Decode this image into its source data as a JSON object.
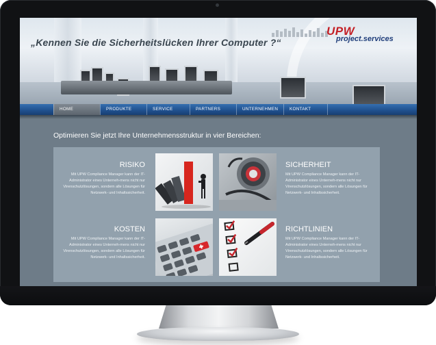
{
  "header": {
    "tagline": "„Kennen Sie die Sicherheitslücken Ihrer Computer ?“",
    "logo_main": "UPW",
    "logo_sub": "project.services"
  },
  "nav": {
    "items": [
      {
        "label": "HOME",
        "active": true
      },
      {
        "label": "PRODUKTE",
        "active": false
      },
      {
        "label": "SERVICE",
        "active": false
      },
      {
        "label": "PARTNERS",
        "active": false
      },
      {
        "label": "UNTERNEHMEN",
        "active": false
      },
      {
        "label": "KONTAKT",
        "active": false
      }
    ]
  },
  "main": {
    "intro": "Optimieren Sie jetzt Ihre Unternehmensstruktur in vier Bereichen:",
    "areas": [
      {
        "title": "RISIKO",
        "text": "Mit UPW Compliance Manager kann der IT-Administrator eines Unterneh-mens nicht nur Virenschutzlösungen, sondern alle Lösungen für Netzwerk- und Inhaltssicherheit.",
        "image": "dominoes-image"
      },
      {
        "title": "SICHERHEIT",
        "text": "Mit UPW Compliance Manager kann der IT-Administrator eines Unterneh-mens nicht nur Virenschutzlösungen, sondern alle Lösungen für Netzwerk- und Inhaltssicherheit.",
        "image": "safe-dial-image"
      },
      {
        "title": "KOSTEN",
        "text": "Mit UPW Compliance Manager kann der IT-Administrator eines Unterneh-mens nicht nur Virenschutzlösungen, sondern alle Lösungen für Netzwerk- und Inhaltssicherheit.",
        "image": "calculator-image"
      },
      {
        "title": "RICHTLINIEN",
        "text": "Mit UPW Compliance Manager kann der IT-Administrator eines Unterneh-mens nicht nur Virenschutzlösungen, sondern alle Lösungen für Netzwerk- und Inhaltssicherheit.",
        "image": "checklist-image"
      }
    ]
  },
  "colors": {
    "brand_red": "#c42026",
    "brand_blue": "#1f3d7a",
    "nav_blue": "#1f4f8d",
    "content_bg": "#6e7c88",
    "panel_bg": "#92a1ad"
  }
}
